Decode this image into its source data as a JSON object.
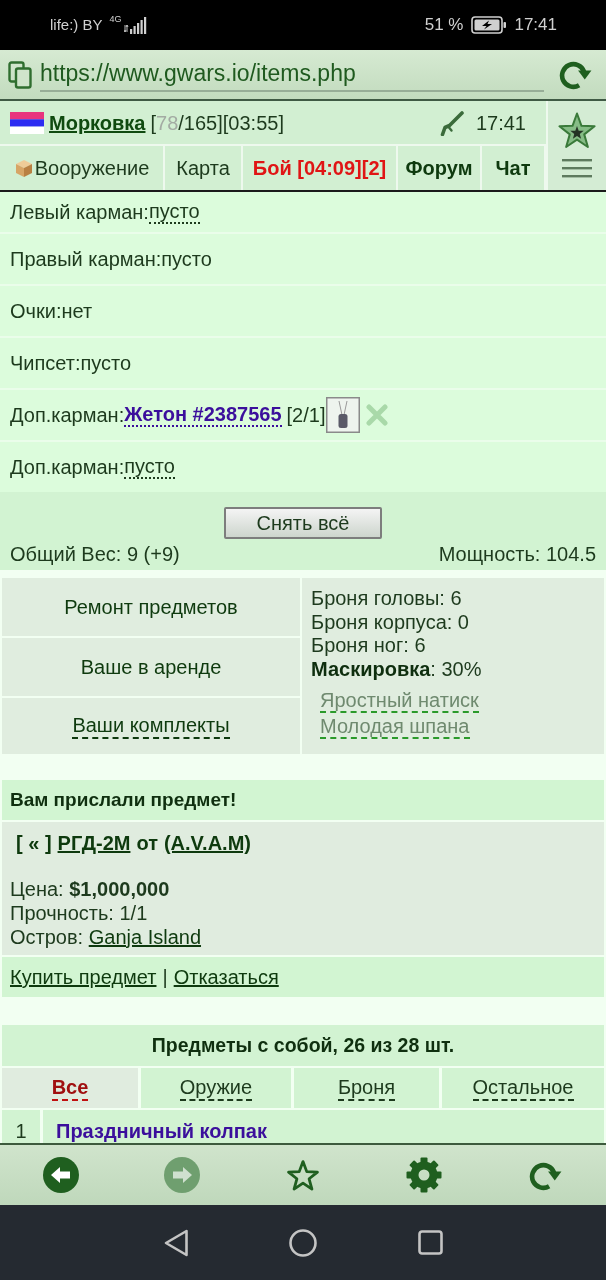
{
  "status_bar": {
    "carrier": "life:) BY",
    "network": "4G",
    "battery": "51 %",
    "time": "17:41"
  },
  "address_bar": {
    "url": "https://www.gwars.io/items.php"
  },
  "header": {
    "player": "Морковка",
    "stats": {
      "open": "[",
      "hp": "78",
      "rest": "/165][03:55]"
    },
    "time": "17:41",
    "tabs": [
      {
        "label": "Вооружение",
        "kind": "plain",
        "icon": true
      },
      {
        "label": "Карта",
        "kind": "plain",
        "icon": false
      },
      {
        "label": "Бой [04:09][2]",
        "kind": "alert",
        "icon": false
      },
      {
        "label": "Форум",
        "kind": "strong",
        "icon": false
      },
      {
        "label": "Чат",
        "kind": "strong",
        "icon": false
      }
    ]
  },
  "slots": [
    {
      "label": "Левый карман:",
      "value": "пусто",
      "kind": "link"
    },
    {
      "label": "Правый карман:",
      "value": "пусто",
      "kind": "text"
    },
    {
      "label": "Очки:",
      "value": "нет",
      "kind": "text"
    },
    {
      "label": "Чипсет:",
      "value": "пусто",
      "kind": "text"
    },
    {
      "label": "Доп.карман:",
      "value": "Жетон #2387565",
      "kind": "item",
      "count": "[2/1]"
    },
    {
      "label": "Доп.карман:",
      "value": "пусто",
      "kind": "link"
    }
  ],
  "unequip": {
    "button": "Снять всё",
    "weight": "Общий Вес: 9 (+9)",
    "power": "Мощность: 104.5"
  },
  "actions": [
    {
      "label": "Ремонт предметов",
      "kind": "text"
    },
    {
      "label": "Ваше в аренде",
      "kind": "text"
    },
    {
      "label": "Ваши комплекты",
      "kind": "link"
    }
  ],
  "armor": {
    "lines": [
      "Броня головы: 6",
      "Броня корпуса: 0",
      "Броня ног: 6",
      "**Маскировка**: 30%"
    ],
    "sets": [
      "Яростный натиск",
      "Молодая шпана"
    ]
  },
  "offer": {
    "title": "Вам прислали предмет!",
    "back": "[ « ]",
    "item": "РГД-2М",
    "from": "от",
    "sender": "(A.V.A.M)",
    "price": "Цена: **$1,000,000**",
    "durability": "Прочность: 1/1",
    "island_label": "Остров:",
    "island": "Ganja Island",
    "buy": "Купить предмет",
    "separator": "|",
    "decline": "Отказаться"
  },
  "inventory": {
    "title": "Предметы с собой, 26 из 28 шт.",
    "filters": [
      {
        "label": "Все",
        "selected": true
      },
      {
        "label": "Оружие",
        "selected": false
      },
      {
        "label": "Броня",
        "selected": false
      },
      {
        "label": "Остальное",
        "selected": false
      }
    ],
    "rows": [
      {
        "number": "1",
        "name": "Праздничный колпак"
      }
    ]
  },
  "toolbar": {
    "buttons": [
      {
        "kind": "back",
        "disabled": false
      },
      {
        "kind": "forward",
        "disabled": true
      },
      {
        "kind": "bookmark",
        "disabled": false
      },
      {
        "kind": "settings",
        "disabled": false
      },
      {
        "kind": "reload",
        "disabled": false
      }
    ]
  }
}
